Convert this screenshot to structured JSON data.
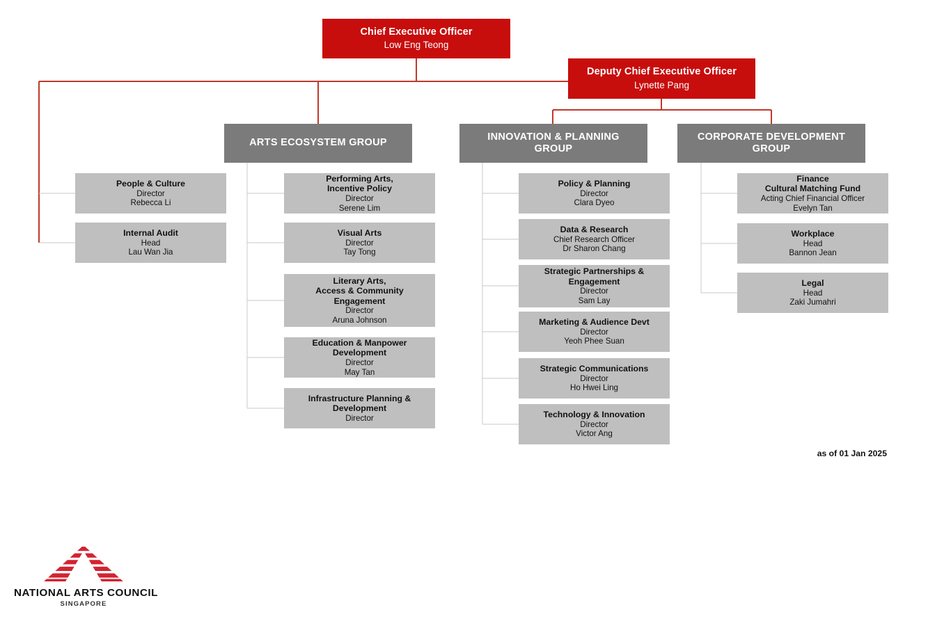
{
  "meta": {
    "as_of": "as of 01 Jan 2025",
    "accent_red": "#C80D0D",
    "group_gray": "#7B7B7B",
    "division_gray": "#BFBFBF",
    "connector_red": "#C0392B",
    "connector_gray": "#C9C9C9"
  },
  "executives": [
    {
      "id": "ceo",
      "title": "Chief Executive Officer",
      "person": "Low Eng Teong"
    },
    {
      "id": "dceo",
      "title": "Deputy Chief Executive Officer",
      "person": "Lynette Pang"
    }
  ],
  "direct_units": [
    {
      "title": "People & Culture",
      "role": "Director",
      "person": "Rebecca Li"
    },
    {
      "title": "Internal Audit",
      "role": "Head",
      "person": "Lau Wan Jia"
    }
  ],
  "groups": [
    {
      "id": "arts-ecosystem-group",
      "name": "ARTS ECOSYSTEM GROUP",
      "divisions": [
        {
          "title": "Performing Arts,\nIncentive Policy",
          "role": "Director",
          "person": "Serene Lim"
        },
        {
          "title": "Visual Arts",
          "role": "Director",
          "person": "Tay Tong"
        },
        {
          "title": "Literary Arts,\nAccess & Community\nEngagement",
          "role": "Director",
          "person": "Aruna Johnson"
        },
        {
          "title": "Education & Manpower\nDevelopment",
          "role": "Director",
          "person": "May Tan"
        },
        {
          "title": "Infrastructure Planning &\nDevelopment",
          "role": "Director",
          "person": ""
        }
      ]
    },
    {
      "id": "innovation-planning-group",
      "name": "INNOVATION & PLANNING\nGROUP",
      "divisions": [
        {
          "title": "Policy & Planning",
          "role": "Director",
          "person": "Clara Dyeo"
        },
        {
          "title": "Data & Research",
          "role": "Chief Research Officer",
          "person": "Dr Sharon Chang"
        },
        {
          "title": "Strategic Partnerships &\nEngagement",
          "role": "Director",
          "person": "Sam Lay"
        },
        {
          "title": "Marketing & Audience Devt",
          "role": "Director",
          "person": "Yeoh Phee Suan"
        },
        {
          "title": "Strategic Communications",
          "role": "Director",
          "person": "Ho Hwei Ling"
        },
        {
          "title": "Technology & Innovation",
          "role": "Director",
          "person": "Victor Ang"
        }
      ]
    },
    {
      "id": "corporate-development-group",
      "name": "CORPORATE DEVELOPMENT\nGROUP",
      "divisions": [
        {
          "title": "Finance\nCultural Matching Fund",
          "role": "Acting Chief Financial Officer",
          "person": "Evelyn Tan"
        },
        {
          "title": "Workplace",
          "role": "Head",
          "person": "Bannon Jean"
        },
        {
          "title": "Legal",
          "role": "Head",
          "person": "Zaki Jumahri"
        }
      ]
    }
  ],
  "logo": {
    "name": "NATIONAL ARTS COUNCIL",
    "subtitle": "SINGAPORE",
    "mark": "nac-mountain-mark"
  }
}
